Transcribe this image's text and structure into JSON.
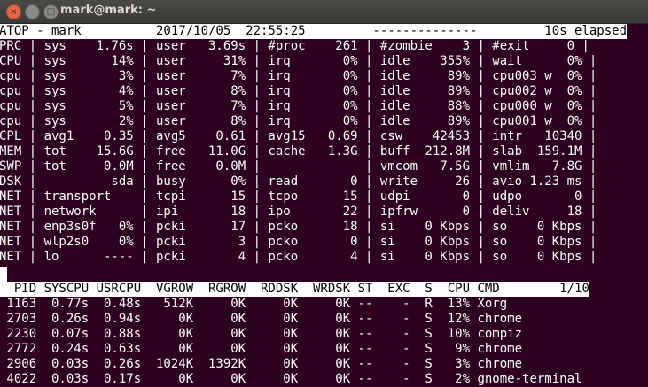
{
  "window": {
    "title": "mark@mark: ~",
    "close_glyph": "×",
    "min_glyph": "–",
    "max_glyph": "□"
  },
  "header_line": "ATOP - mark          2017/10/05  22:55:25         --------------         10s elapsed",
  "system_lines": [
    "PRC | sys    1.76s | user   3.69s | #proc    261 | #zombie    3 | #exit     0 |",
    "CPU | sys      14% | user     31% | irq       0% | idle    355% | wait      0% |",
    "cpu | sys       3% | user      7% | irq       0% | idle     89% | cpu003 w  0% |",
    "cpu | sys       4% | user      8% | irq       0% | idle     89% | cpu002 w  0% |",
    "cpu | sys       5% | user      7% | irq       0% | idle     88% | cpu000 w  0% |",
    "cpu | sys       2% | user      8% | irq       0% | idle     89% | cpu001 w  0% |",
    "CPL | avg1    0.35 | avg5    0.61 | avg15   0.69 | csw    42453 | intr   10340 |",
    "MEM | tot    15.6G | free   11.0G | cache   1.3G | buff  212.8M | slab  159.1M |",
    "SWP | tot     0.0M | free    0.0M |              | vmcom   7.5G | vmlim   7.8G |",
    "DSK |          sda | busy      0% | read       0 | write     26 | avio 1.23 ms |",
    "NET | transport    | tcpi      15 | tcpo      15 | udpi       0 | udpo       0 |",
    "NET | network      | ipi       18 | ipo       22 | ipfrw      0 | deliv     18 |",
    "NET | enp3s0f   0% | pcki      17 | pcko      18 | si    0 Kbps | so    0 Kbps |",
    "NET | wlp2s0    0% | pcki       3 | pcko       0 | si    0 Kbps | so    0 Kbps |",
    "NET | lo      ---- | pcki       4 | pcko       4 | si    0 Kbps | so    0 Kbps |"
  ],
  "process_header": "  PID SYSCPU USRCPU  VGROW  RGROW  RDDSK  WRDSK ST  EXC  S  CPU CMD        1/10",
  "process_rows": [
    " 1163  0.77s  0.48s   512K     0K     0K     0K --    -  R  13% Xorg",
    " 2703  0.26s  0.94s     0K     0K     0K     0K --    -  S  12% chrome",
    " 2230  0.07s  0.88s     0K     0K     0K     0K --    -  S  10% compiz",
    " 2772  0.24s  0.63s     0K     0K     0K     0K --    -  S   9% chrome",
    " 2906  0.03s  0.26s  1024K  1392K     0K     0K --    -  S   3% chrome",
    " 4022  0.03s  0.17s     0K     0K     0K     0K --    -  S   2% gnome-terminal"
  ],
  "colors": {
    "background": "#2c001e",
    "text": "#ffffff",
    "inverse_bg": "#ffffff",
    "inverse_text": "#000000"
  }
}
